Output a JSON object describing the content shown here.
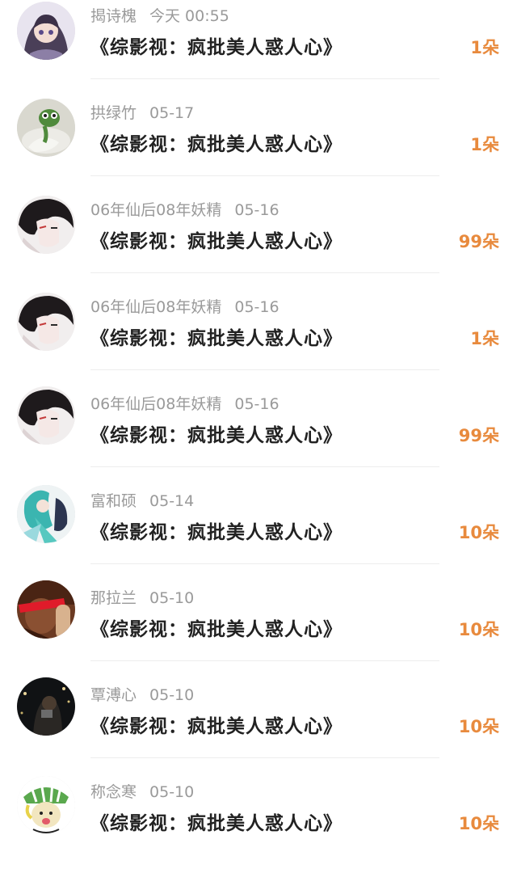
{
  "gifts": [
    {
      "user": "揭诗槐",
      "time": "今天 00:55",
      "book": "《综影视：疯批美人惑人心》",
      "amount": "1朵",
      "avatar": "anime-girl-avatar-icon"
    },
    {
      "user": "拱绿竹",
      "time": "05-17",
      "book": "《综影视：疯批美人惑人心》",
      "amount": "1朵",
      "avatar": "green-frog-avatar-icon"
    },
    {
      "user": "06年仙后08年妖精",
      "time": "05-16",
      "book": "《综影视：疯批美人惑人心》",
      "amount": "99朵",
      "avatar": "dark-hair-man-avatar-icon"
    },
    {
      "user": "06年仙后08年妖精",
      "time": "05-16",
      "book": "《综影视：疯批美人惑人心》",
      "amount": "1朵",
      "avatar": "dark-hair-man-avatar-icon"
    },
    {
      "user": "06年仙后08年妖精",
      "time": "05-16",
      "book": "《综影视：疯批美人惑人心》",
      "amount": "99朵",
      "avatar": "dark-hair-man-avatar-icon"
    },
    {
      "user": "富和硕",
      "time": "05-14",
      "book": "《综影视：疯批美人惑人心》",
      "amount": "10朵",
      "avatar": "teal-hair-character-avatar-icon"
    },
    {
      "user": "那拉兰",
      "time": "05-10",
      "book": "《综影视：疯批美人惑人心》",
      "amount": "10朵",
      "avatar": "red-visor-figure-avatar-icon"
    },
    {
      "user": "覃溥心",
      "time": "05-10",
      "book": "《综影视：疯批美人惑人心》",
      "amount": "10朵",
      "avatar": "night-city-avatar-icon"
    },
    {
      "user": "称念寒",
      "time": "05-10",
      "book": "《综影视：疯批美人惑人心》",
      "amount": "10朵",
      "avatar": "green-hat-cartoon-avatar-icon"
    }
  ],
  "colors": {
    "amount": "#e88a3d",
    "meta": "#9a9a9a",
    "title": "#222222",
    "divider": "#ededed"
  }
}
